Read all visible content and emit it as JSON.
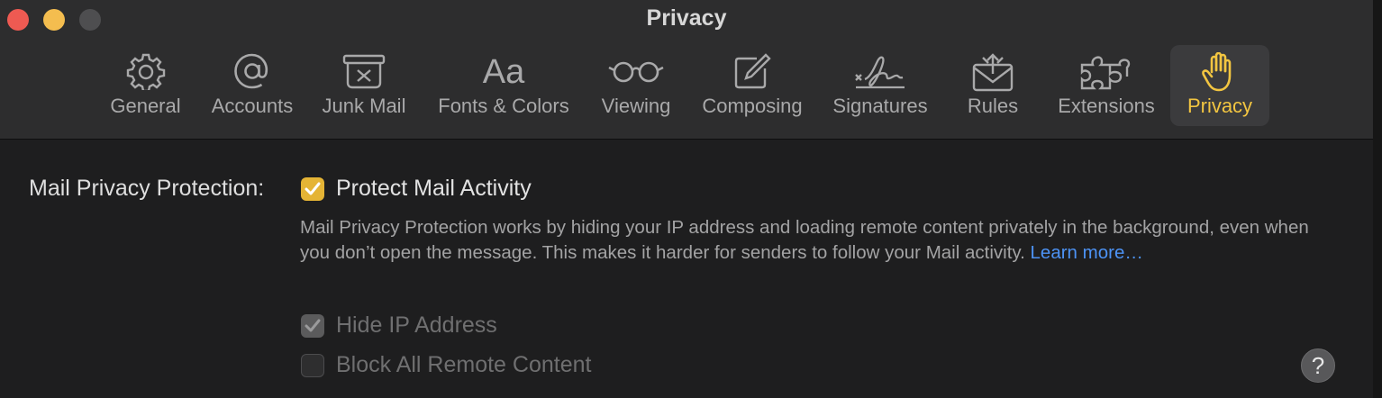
{
  "window": {
    "title": "Privacy"
  },
  "tabs": [
    {
      "label": "General",
      "icon": "gear-icon"
    },
    {
      "label": "Accounts",
      "icon": "at-sign-icon"
    },
    {
      "label": "Junk Mail",
      "icon": "junk-mail-icon"
    },
    {
      "label": "Fonts & Colors",
      "icon": "fonts-icon",
      "glyph": "Aa"
    },
    {
      "label": "Viewing",
      "icon": "glasses-icon"
    },
    {
      "label": "Composing",
      "icon": "compose-icon"
    },
    {
      "label": "Signatures",
      "icon": "signature-icon"
    },
    {
      "label": "Rules",
      "icon": "rules-envelope-icon"
    },
    {
      "label": "Extensions",
      "icon": "puzzle-icon"
    },
    {
      "label": "Privacy",
      "icon": "hand-icon",
      "selected": true
    }
  ],
  "privacy": {
    "section_label": "Mail Privacy Protection:",
    "protect_activity": {
      "label": "Protect Mail Activity",
      "checked": true
    },
    "description": "Mail Privacy Protection works by hiding your IP address and loading remote content privately in the background, even when you don’t open the message. This makes it harder for senders to follow your Mail activity.",
    "learn_more": "Learn more…",
    "hide_ip": {
      "label": "Hide IP Address",
      "checked": true,
      "disabled": true
    },
    "block_remote": {
      "label": "Block All Remote Content",
      "checked": false,
      "disabled": true
    }
  },
  "help_button": {
    "glyph": "?"
  },
  "colors": {
    "accent": "#e5b435",
    "link": "#4d93f5",
    "selected_tab_label": "#f2c541",
    "close": "#ee5a52",
    "minimize": "#f4bd4f"
  }
}
